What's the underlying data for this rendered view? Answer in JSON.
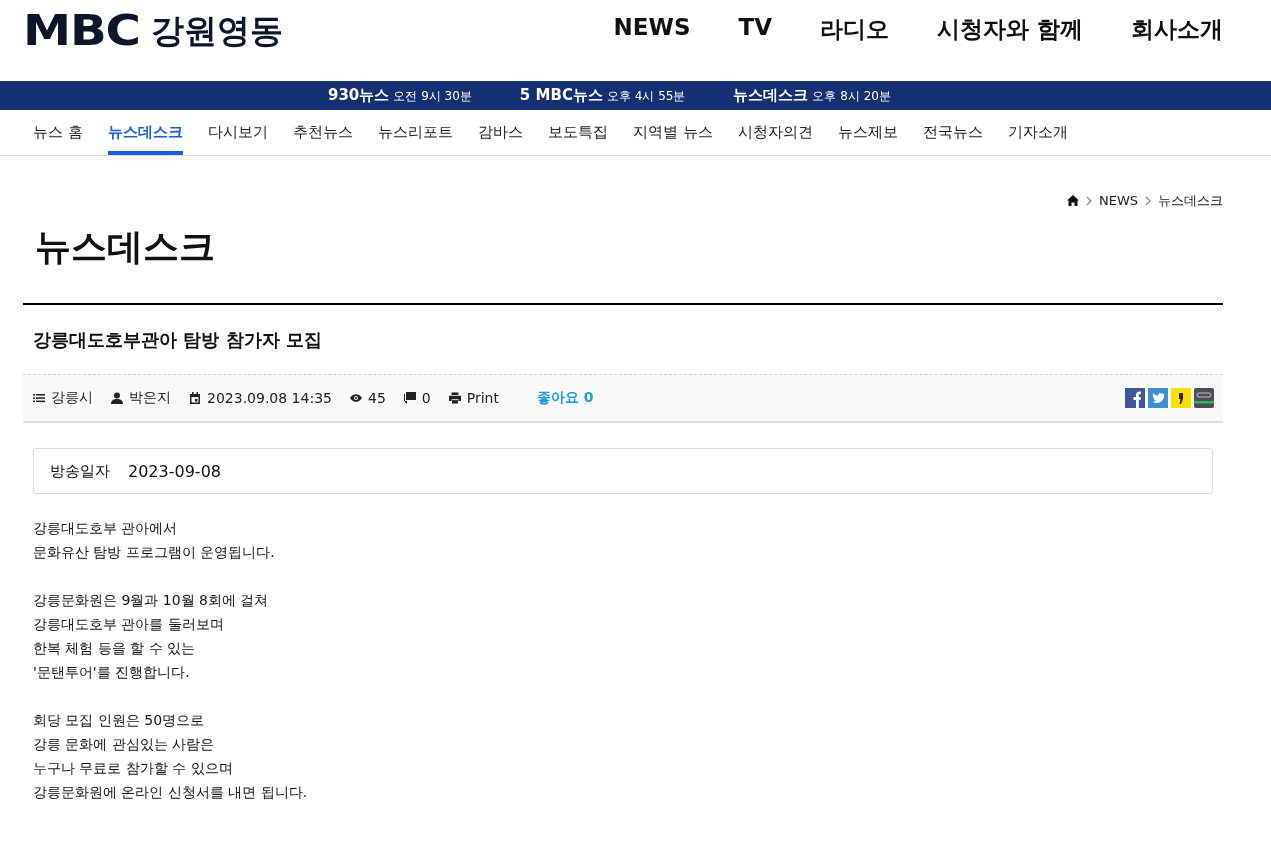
{
  "logo": {
    "brand": "MBC",
    "region": "강원영동"
  },
  "main_nav": [
    "NEWS",
    "TV",
    "라디오",
    "시청자와 함께",
    "회사소개"
  ],
  "schedule": [
    {
      "name": "930뉴스",
      "time": "오전 9시 30분"
    },
    {
      "name": "5 MBC뉴스",
      "time": "오후 4시 55분"
    },
    {
      "name": "뉴스데스크",
      "time": "오후 8시 20분"
    }
  ],
  "sub_nav": [
    {
      "label": "뉴스 홈",
      "selected": false
    },
    {
      "label": "뉴스데스크",
      "selected": true
    },
    {
      "label": "다시보기",
      "selected": false
    },
    {
      "label": "추천뉴스",
      "selected": false
    },
    {
      "label": "뉴스리포트",
      "selected": false
    },
    {
      "label": "감바스",
      "selected": false
    },
    {
      "label": "보도특집",
      "selected": false
    },
    {
      "label": "지역별 뉴스",
      "selected": false
    },
    {
      "label": "시청자의견",
      "selected": false
    },
    {
      "label": "뉴스제보",
      "selected": false
    },
    {
      "label": "전국뉴스",
      "selected": false
    },
    {
      "label": "기자소개",
      "selected": false
    }
  ],
  "breadcrumb": [
    "NEWS",
    "뉴스데스크"
  ],
  "page_title": "뉴스데스크",
  "article": {
    "title": "강릉대도호부관아 탐방 참가자 모집",
    "meta": {
      "category": "강릉시",
      "author": "박은지",
      "date": "2023.09.08 14:35",
      "views": "45",
      "comments": "0",
      "print": "Print",
      "likes": "좋아요 0"
    },
    "broadcast": {
      "label": "방송일자",
      "date": "2023-09-08"
    },
    "body": [
      [
        "강릉대도호부 관아에서",
        "문화유산 탐방 프로그램이 운영됩니다."
      ],
      [
        "강릉문화원은 9월과 10월 8회에 걸쳐",
        "강릉대도호부 관아를 둘러보며",
        "한복 체험 등을 할 수 있는",
        "'문탠투어'를 진행합니다."
      ],
      [
        "회당 모집 인원은 50명으로",
        "강릉 문화에 관심있는 사람은",
        "누구나 무료로 참가할 수 있으며",
        "강릉문화원에 온라인 신청서를 내면 됩니다."
      ]
    ]
  }
}
